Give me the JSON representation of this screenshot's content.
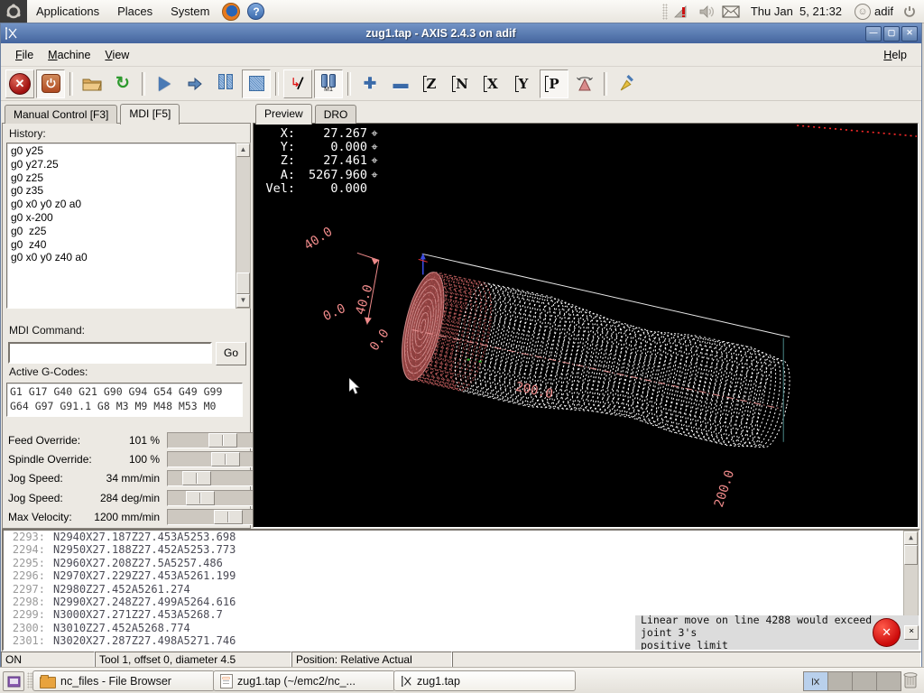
{
  "colors": {
    "titlebar": "#44659e",
    "panel_bg": "#ece9e3",
    "canvas_bg": "#000000",
    "toolpath_white": "#ffffff",
    "toolpath_red": "#b75b5b",
    "dim_label_pink": "#ef8a8a",
    "error_red": "#cc0a0a",
    "accent_blue": "#4a7ab5"
  },
  "panel": {
    "apps": "Applications",
    "places": "Places",
    "system": "System",
    "clock": "Thu Jan  5, 21:32",
    "user": "adif"
  },
  "titlebar": {
    "title": "zug1.tap - AXIS 2.4.3 on adif"
  },
  "menubar": {
    "file": "File",
    "machine": "Machine",
    "view": "View",
    "help": "Help"
  },
  "toolbar": {
    "m1": "M1",
    "z": "Z",
    "n": "N",
    "x": "X",
    "y": "Y",
    "p": "P"
  },
  "left": {
    "tab_manual": "Manual Control [F3]",
    "tab_mdi": "MDI [F5]",
    "history_label": "History:",
    "history": [
      "g0 y25",
      "g0 y27.25",
      "g0 z25",
      "g0 z35",
      "g0 x0 y0 z0 a0",
      "g0 x-200",
      "g0  z25",
      "g0  z40",
      "g0 x0 y0 z40 a0"
    ],
    "mdi_label": "MDI Command:",
    "mdi_value": "",
    "go": "Go",
    "gcodes_label": "Active G-Codes:",
    "gcodes_line1": "G1 G17 G40 G21 G90 G94 G54 G49 G99",
    "gcodes_line2": "G64 G97 G91.1 G8 M3 M9 M48 M53 M0"
  },
  "sliders": [
    {
      "label": "Feed Override:",
      "value": "101 %",
      "pos": 0.71
    },
    {
      "label": "Spindle Override:",
      "value": "100 %",
      "pos": 0.75
    },
    {
      "label": "Jog Speed:",
      "value": "34 mm/min",
      "pos": 0.25
    },
    {
      "label": "Jog Speed:",
      "value": "284 deg/min",
      "pos": 0.32
    },
    {
      "label": "Max Velocity:",
      "value": "1200 mm/min",
      "pos": 0.8
    }
  ],
  "preview": {
    "tab_preview": "Preview",
    "tab_dro": "DRO",
    "dro": [
      {
        "label": "X:",
        "value": "27.267"
      },
      {
        "label": "Y:",
        "value": "0.000"
      },
      {
        "label": "Z:",
        "value": "27.461"
      },
      {
        "label": "A:",
        "value": "5267.960"
      },
      {
        "label": "Vel:",
        "value": "0.000"
      }
    ],
    "labels": {
      "dim_y_top": "40.0",
      "dim_y_side": "40.0",
      "dim_zero_a": "0.0",
      "dim_zero_b": "0.0",
      "length_center": "200.0",
      "length_end": "200.0"
    }
  },
  "gcode": {
    "lines": [
      {
        "n": "2293:",
        "t": "N2940X27.187Z27.453A5253.698"
      },
      {
        "n": "2294:",
        "t": "N2950X27.188Z27.452A5253.773"
      },
      {
        "n": "2295:",
        "t": "N2960X27.208Z27.5A5257.486"
      },
      {
        "n": "2296:",
        "t": "N2970X27.229Z27.453A5261.199"
      },
      {
        "n": "2297:",
        "t": "N2980Z27.452A5261.274"
      },
      {
        "n": "2298:",
        "t": "N2990X27.248Z27.499A5264.616"
      },
      {
        "n": "2299:",
        "t": "N3000X27.271Z27.453A5268.7"
      },
      {
        "n": "2300:",
        "t": "N3010Z27.452A5268.774"
      },
      {
        "n": "2301:",
        "t": "N3020X27.287Z27.498A5271.746"
      }
    ]
  },
  "statusbar": {
    "power": "ON",
    "tool": "Tool 1, offset 0, diameter 4.5",
    "position": "Position: Relative Actual"
  },
  "notification": {
    "line1": "Linear move on line 4288 would exceed joint 3's",
    "line2": "positive limit"
  },
  "taskbar": {
    "items": [
      "nc_files - File Browser",
      "zug1.tap (~/emc2/nc_...",
      "zug1.tap"
    ]
  }
}
